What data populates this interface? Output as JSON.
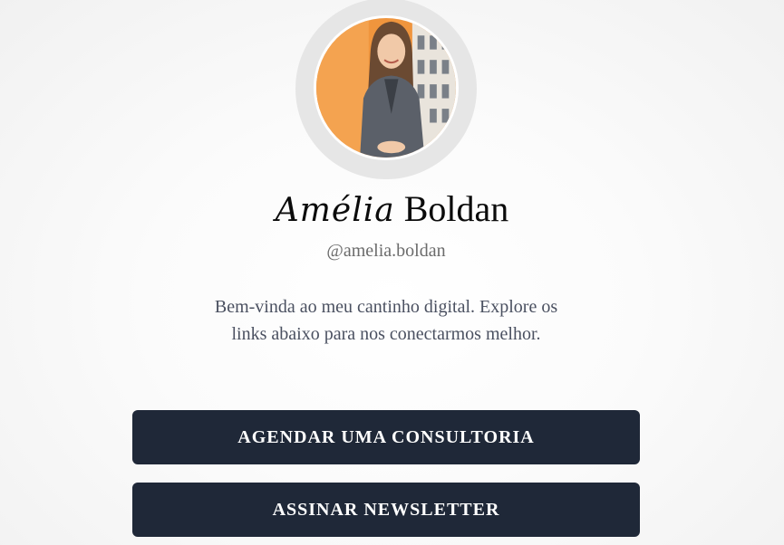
{
  "profile": {
    "first_name": "Amélia",
    "last_name": "Boldan",
    "handle": "@amelia.boldan",
    "bio": "Bem-vinda ao meu cantinho digital. Explore os links abaixo para nos conectarmos melhor.",
    "avatar_alt": "Amélia Boldan"
  },
  "links": [
    {
      "label": "AGENDAR UMA CONSULTORIA"
    },
    {
      "label": "ASSINAR NEWSLETTER"
    }
  ],
  "colors": {
    "button_bg": "#1f2838",
    "button_text": "#ffffff",
    "ring": "#e6e6e6"
  }
}
